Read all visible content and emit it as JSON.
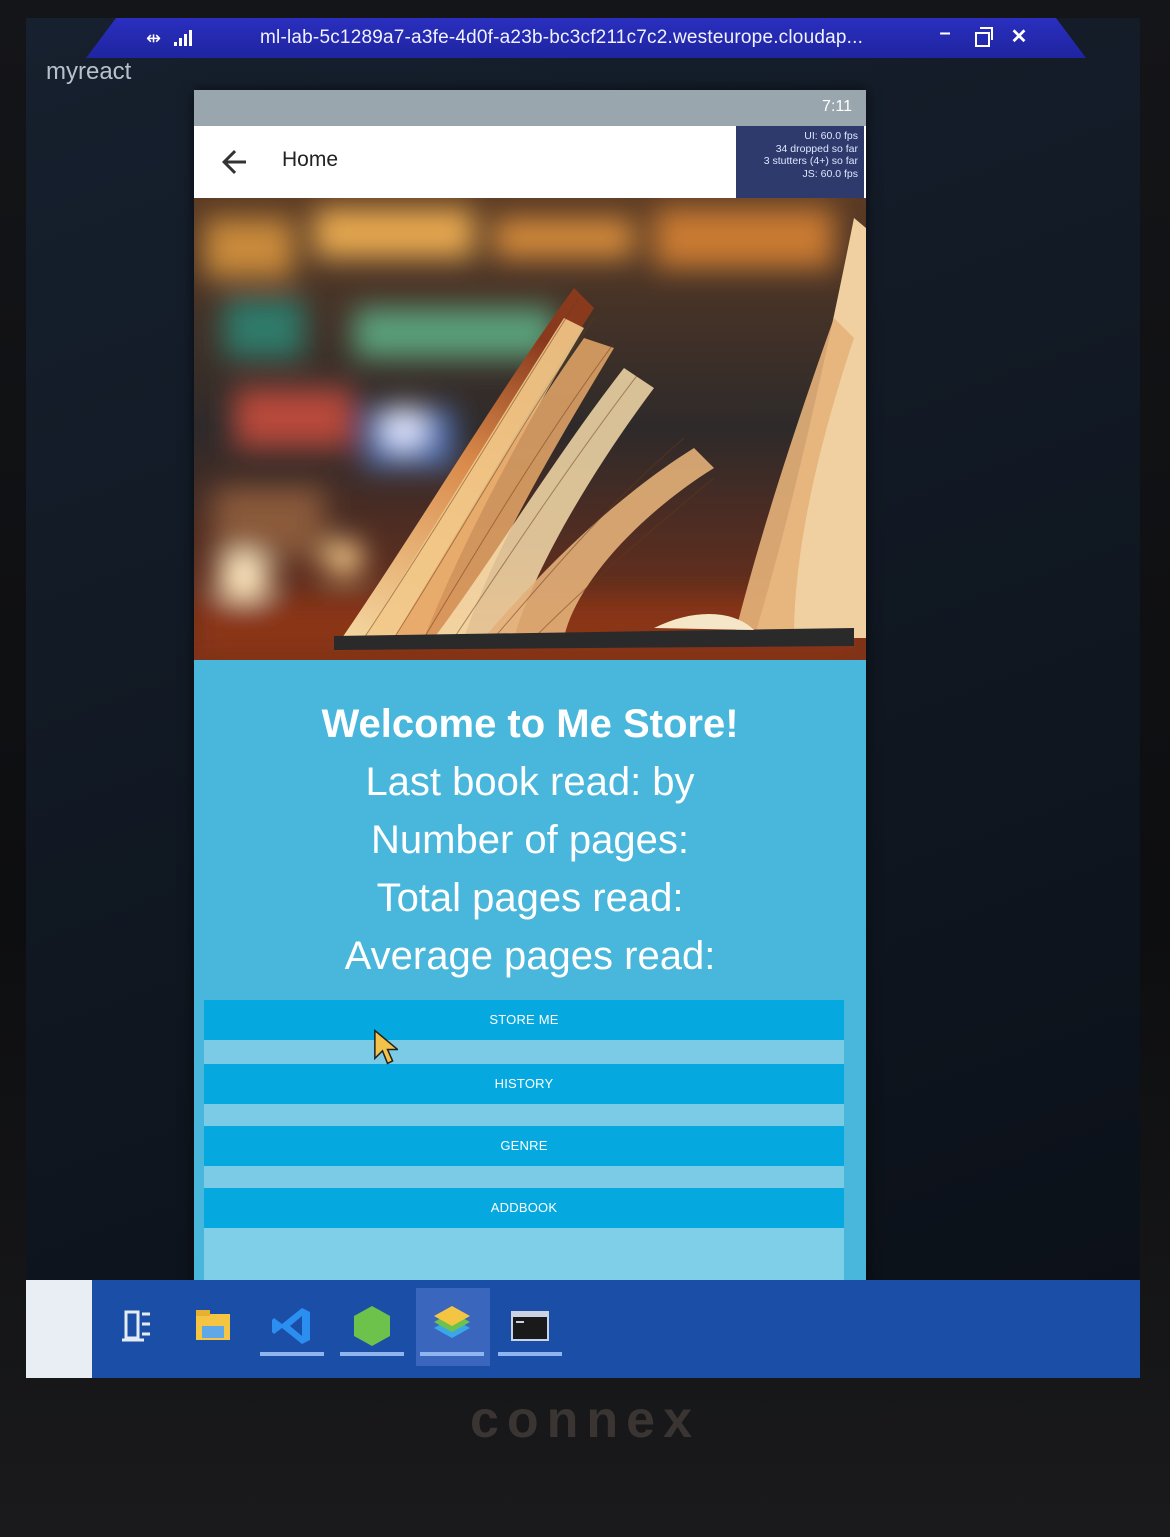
{
  "remote": {
    "title": "ml-lab-5c1289a7-a3fe-4d0f-a23b-bc3cf211c7c2.westeurope.cloudap...",
    "pin_icon": "pin-icon",
    "signal_icon": "signal-icon"
  },
  "desktop": {
    "label": "myreact"
  },
  "emulator": {
    "status_time": "7:11",
    "appbar": {
      "title": "Home",
      "back_icon": "arrow-left-icon"
    },
    "perf_monitor": {
      "line1": "UI: 60.0 fps",
      "line2": "34 dropped so far",
      "line3": "3 stutters (4+) so far",
      "line4": "JS: 60.0 fps"
    },
    "home": {
      "welcome": "Welcome to Me Store!",
      "last_book": "Last book read:  by",
      "num_pages": "Number of pages:",
      "total_pages": "Total pages read:",
      "avg_pages": "Average pages read:"
    },
    "buttons": {
      "store_me": "STORE ME",
      "history": "HISTORY",
      "genre": "GENRE",
      "addbook": "ADDBOOK"
    }
  },
  "taskbar": {
    "icons": [
      "task-view-icon",
      "file-explorer-icon",
      "vscode-icon",
      "nodejs-icon",
      "bluestacks-icon",
      "terminal-icon"
    ]
  },
  "bezel": {
    "brand": "connex"
  },
  "colors": {
    "rdp_bar": "#2a2fbf",
    "content_bg": "#49b6dc",
    "button_bg": "#05a9df",
    "taskbar": "#1b4ea6"
  }
}
